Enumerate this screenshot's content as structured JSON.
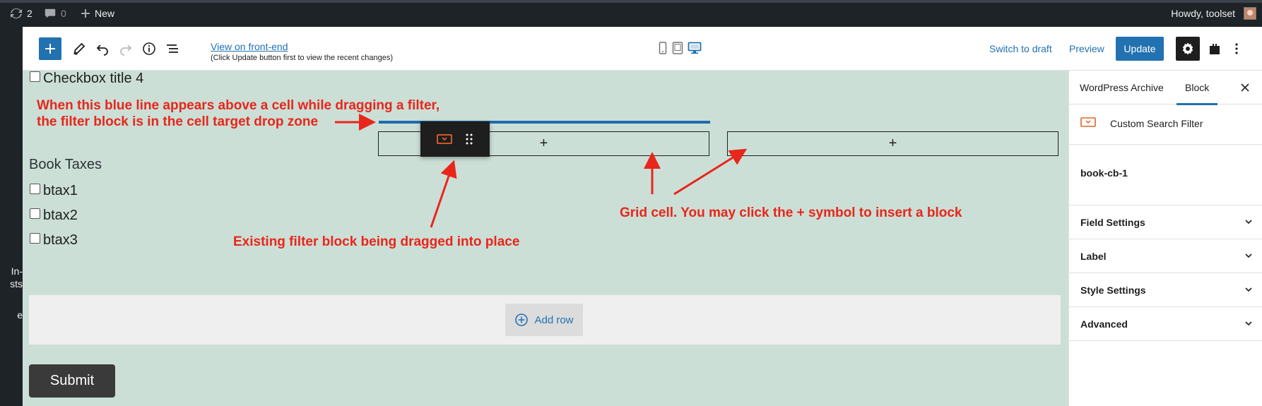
{
  "admin_bar": {
    "updates_count": "2",
    "comments_count": "0",
    "new_label": "New",
    "howdy": "Howdy, toolset"
  },
  "left_menu": {
    "fragments": [
      "In-",
      "sts",
      "e"
    ]
  },
  "header": {
    "view_front_end": "View on front-end",
    "view_note": "(Click Update button first to view the recent changes)",
    "switch_to_draft": "Switch to draft",
    "preview": "Preview",
    "update": "Update",
    "icons": [
      "plus-icon",
      "pencil-icon",
      "undo-icon",
      "redo-icon",
      "info-icon",
      "list-view-icon",
      "mobile-icon",
      "tablet-icon",
      "desktop-icon",
      "gear-icon",
      "block-plugin-icon",
      "more-vertical-icon"
    ]
  },
  "canvas": {
    "checkbox_top": "Checkbox title 4",
    "section_title": "Book Taxes",
    "checkboxes": [
      "btax1",
      "btax2",
      "btax3"
    ],
    "cell_plus": "+",
    "add_row": "Add row",
    "submit": "Submit",
    "annotations": {
      "blue_line_1": "When this blue line appears above a cell while dragging a filter,",
      "blue_line_2": "the filter block is in the cell target drop zone",
      "grid_cell": "Grid cell. You may click the + symbol to insert a block",
      "dragged": "Existing filter block being dragged into place"
    }
  },
  "sidebar": {
    "tabs": [
      "WordPress Archive",
      "Block"
    ],
    "active_tab": "Block",
    "block_title": "Custom Search Filter",
    "block_slug": "book-cb-1",
    "panels": [
      "Field Settings",
      "Label",
      "Style Settings",
      "Advanced"
    ]
  },
  "colors": {
    "accent": "#2271b1",
    "canvas_bg": "#ccdfd6",
    "annotation_red": "#e8261b",
    "drop_line": "#1e6bb0",
    "admin_bar": "#1d2327",
    "filter_icon_orange": "#e0632d"
  }
}
